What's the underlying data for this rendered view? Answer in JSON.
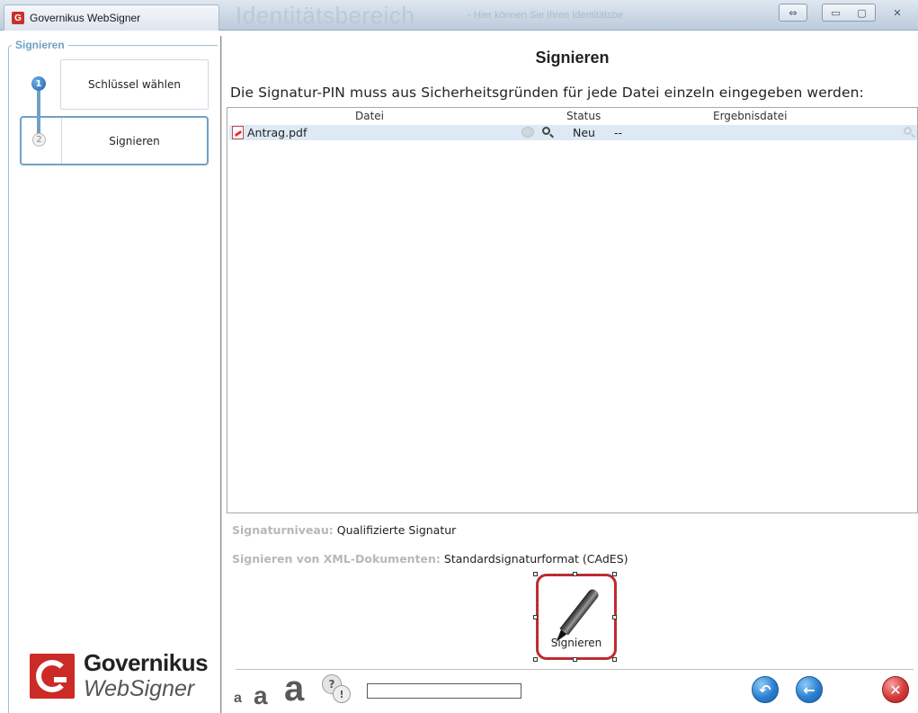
{
  "window": {
    "app_title": "Governikus WebSigner",
    "background_title": "Identitätsbereich",
    "background_subtitle": "- Hier können Sie Ihren Identitätsbe"
  },
  "sidebar": {
    "legend": "Signieren",
    "steps": [
      {
        "number": "1",
        "label": "Schlüssel wählen",
        "state": "done"
      },
      {
        "number": "2",
        "label": "Signieren",
        "state": "active"
      }
    ],
    "logo": {
      "name": "Governikus",
      "product": "WebSigner"
    }
  },
  "main": {
    "title": "Signieren",
    "instruction": "Die Signatur-PIN muss aus Sicherheitsgründen für jede Datei einzeln eingegeben werden:",
    "table": {
      "columns": [
        "Datei",
        "Status",
        "Ergebnisdatei"
      ],
      "rows": [
        {
          "file": "Antrag.pdf",
          "status": "Neu",
          "result": "--"
        }
      ]
    },
    "info": {
      "level_label": "Signaturniveau:",
      "level_value": "Qualifizierte Signatur",
      "xml_label": "Signieren von XML-Dokumenten:",
      "xml_value": "Standardsignaturformat (CAdES)"
    },
    "sign_button": {
      "label": "Signieren"
    }
  },
  "footer": {
    "font_small": "a",
    "font_medium": "a",
    "font_large": "a",
    "help_q": "?",
    "help_excl": "!",
    "progress": 0
  },
  "colors": {
    "accent": "#6fa1c4",
    "brand_red": "#cc2a26",
    "row_highlight": "#dde9f4"
  }
}
